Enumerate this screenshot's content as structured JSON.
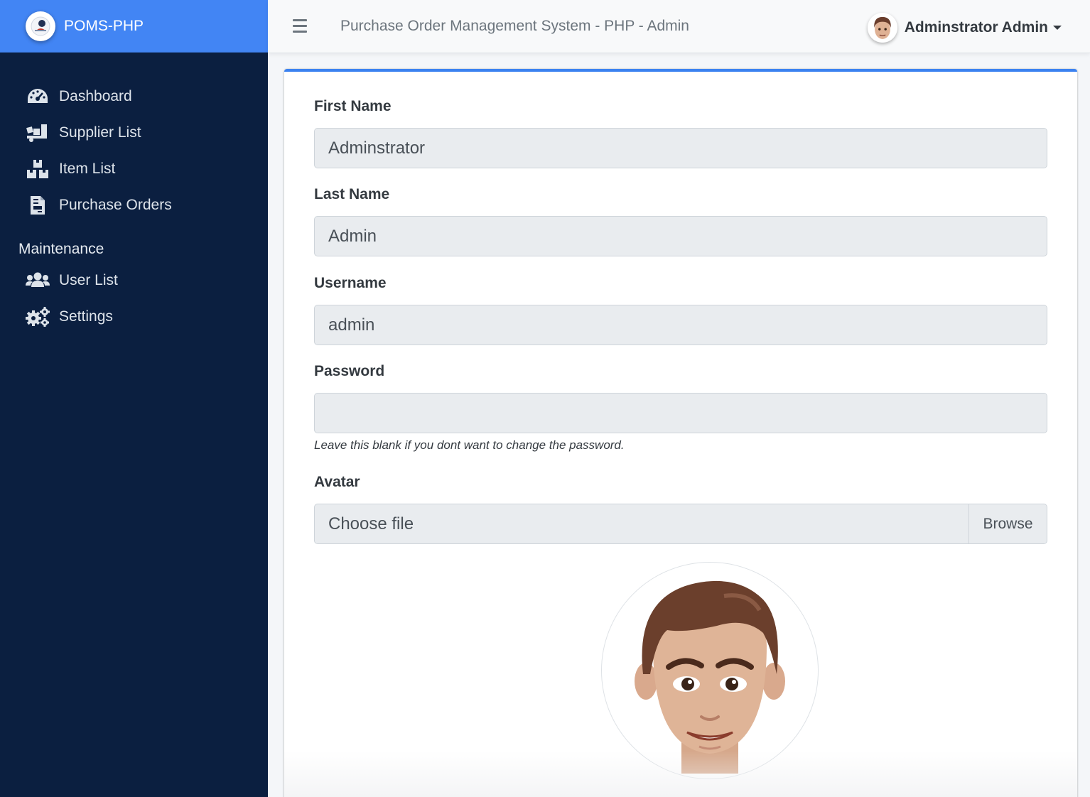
{
  "brand": {
    "name": "POMS-PHP"
  },
  "sidebar": {
    "items": [
      {
        "label": "Dashboard",
        "icon": "tachometer-icon"
      },
      {
        "label": "Supplier List",
        "icon": "truck-loading-icon"
      },
      {
        "label": "Item List",
        "icon": "boxes-icon"
      },
      {
        "label": "Purchase Orders",
        "icon": "file-invoice-icon"
      }
    ],
    "section_header": "Maintenance",
    "maintenance_items": [
      {
        "label": "User List",
        "icon": "users-icon"
      },
      {
        "label": "Settings",
        "icon": "cogs-icon"
      }
    ]
  },
  "topbar": {
    "title": "Purchase Order Management System - PHP - Admin",
    "user_name": "Adminstrator Admin"
  },
  "form": {
    "first_name": {
      "label": "First Name",
      "value": "Adminstrator"
    },
    "last_name": {
      "label": "Last Name",
      "value": "Admin"
    },
    "username": {
      "label": "Username",
      "value": "admin"
    },
    "password": {
      "label": "Password",
      "value": "",
      "hint": "Leave this blank if you dont want to change the password."
    },
    "avatar": {
      "label": "Avatar",
      "placeholder": "Choose file",
      "browse_label": "Browse"
    }
  },
  "colors": {
    "sidebar_bg": "#0b1f40",
    "brand_bg": "#4285f4",
    "card_accent": "#3b82f0"
  }
}
